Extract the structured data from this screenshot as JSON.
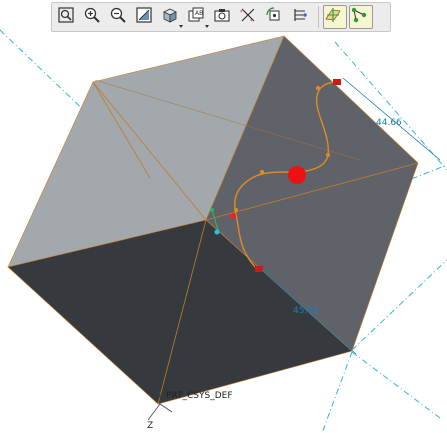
{
  "toolbar": {
    "buttons": [
      {
        "name": "zoom-fit-button",
        "icon": "refit-icon",
        "active": false
      },
      {
        "name": "zoom-in-button",
        "icon": "zoom-in-icon",
        "active": false
      },
      {
        "name": "zoom-out-button",
        "icon": "zoom-out-icon",
        "active": false
      },
      {
        "name": "repaint-button",
        "icon": "repaint-icon",
        "active": false
      },
      {
        "name": "display-style-button",
        "icon": "shaded-cube-icon",
        "active": false
      },
      {
        "name": "saved-views-button",
        "icon": "saved-views-icon",
        "active": false
      },
      {
        "name": "view-manager-button",
        "icon": "camera-icon",
        "active": false
      },
      {
        "name": "datum-display-button",
        "icon": "datum-display-icon",
        "active": false
      },
      {
        "name": "spin-center-button",
        "icon": "spin-center-icon",
        "active": false
      },
      {
        "name": "annotation-display-button",
        "icon": "annotation-icon",
        "active": false
      },
      {
        "name": "datum-planes-button",
        "icon": "datum-plane-icon",
        "active": true
      },
      {
        "name": "datum-points-button",
        "icon": "datum-point-icon",
        "active": true
      }
    ]
  },
  "model": {
    "dimension_top": "44.66",
    "dimension_bottom": "45.63",
    "csys_label": "PRT_CSYS_DEF",
    "csys_axis_label": "Z"
  },
  "colors": {
    "face_left": "#9ea3a8",
    "face_right": "#5e6268",
    "face_bottom": "#35393d",
    "curve": "#e08a25",
    "point_red": "#ee1111",
    "datum_line": "#22b8d8",
    "dimension": "#1a7fb5"
  }
}
